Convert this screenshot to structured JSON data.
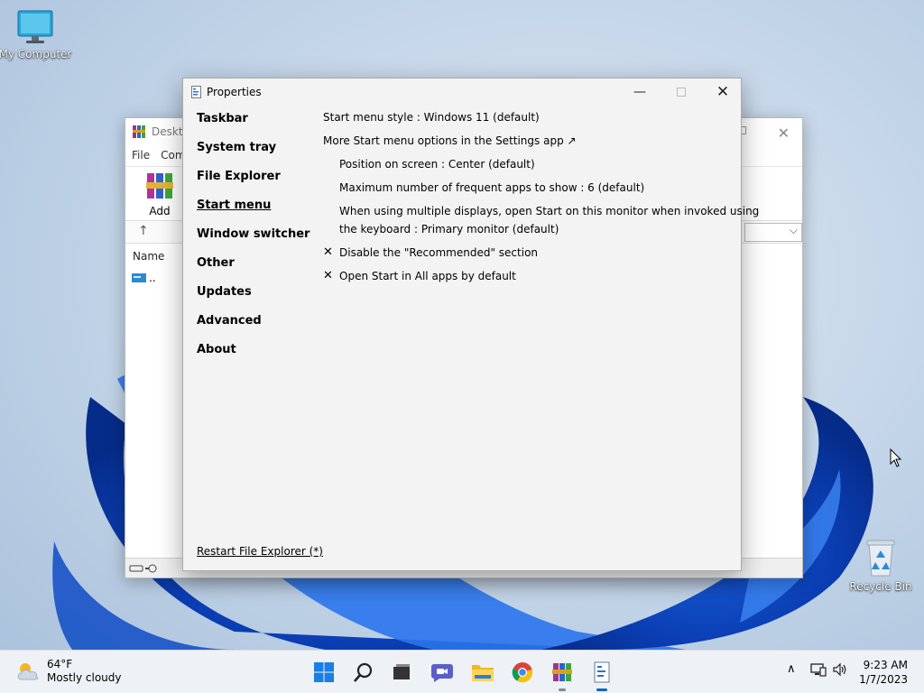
{
  "desktop": {
    "my_computer_label": "My Computer",
    "recycle_bin_label": "Recycle Bin"
  },
  "winrar": {
    "title": "Deskto",
    "menu": [
      "File",
      "Com"
    ],
    "add_label": "Add",
    "column_name": "Name",
    "row_parent": ".."
  },
  "properties": {
    "title": "Properties",
    "nav": [
      "Taskbar",
      "System tray",
      "File Explorer",
      "Start menu",
      "Window switcher",
      "Other",
      "Updates",
      "Advanced",
      "About"
    ],
    "active_nav": "Start menu",
    "settings": {
      "start_menu_style": "Start menu style : Windows 11 (default)",
      "more_options_link": "More Start menu options in the Settings app ↗",
      "position": "Position on screen : Center (default)",
      "max_frequent": "Maximum number of frequent apps to show : 6 (default)",
      "multi_display_1": "When using multiple displays, open Start on this monitor when invoked using",
      "multi_display_2": "the keyboard : Primary monitor (default)",
      "disable_recommended": "Disable the \"Recommended\" section",
      "open_all_apps": "Open Start in All apps by default",
      "check_mark": "✕"
    },
    "restart_link": "Restart File Explorer (*)"
  },
  "taskbar": {
    "weather_temp": "64°F",
    "weather_desc": "Mostly cloudy",
    "time": "9:23 AM",
    "date": "1/7/2023",
    "tray_chevron": "∧",
    "accent": "#0a64d2"
  }
}
